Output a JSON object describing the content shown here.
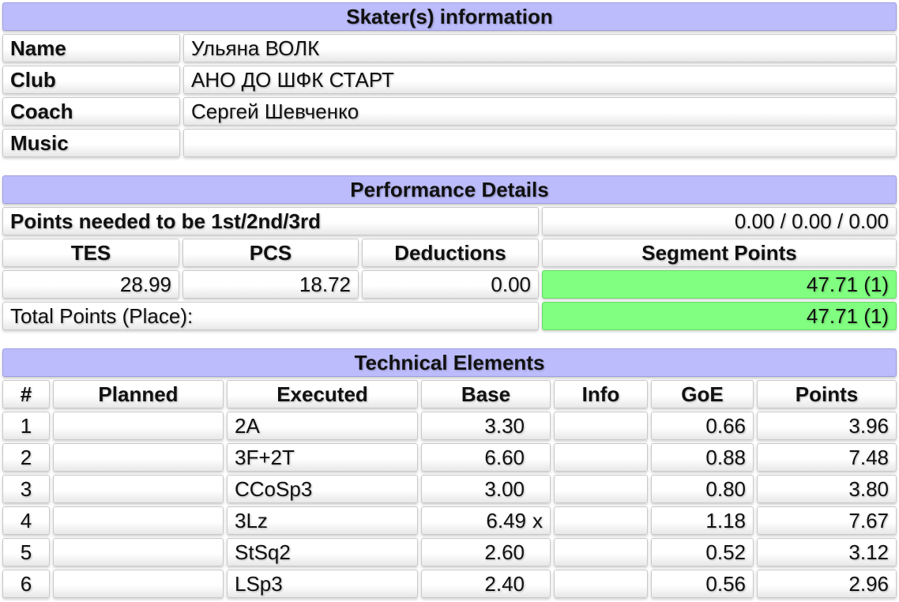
{
  "skater": {
    "header": "Skater(s) information",
    "rows": [
      {
        "label": "Name",
        "value": "Ульяна ВОЛК"
      },
      {
        "label": "Club",
        "value": "АНО ДО ШФК СТАРТ"
      },
      {
        "label": "Coach",
        "value": "Сергей Шевченко"
      },
      {
        "label": "Music",
        "value": ""
      }
    ]
  },
  "performance": {
    "header": "Performance Details",
    "needed_label": "Points needed to be 1st/2nd/3rd",
    "needed_value": "0.00 / 0.00 / 0.00",
    "columns": {
      "tes": "TES",
      "pcs": "PCS",
      "deductions": "Deductions",
      "segment": "Segment Points"
    },
    "values": {
      "tes": "28.99",
      "pcs": "18.72",
      "deductions": "0.00",
      "segment": "47.71 (1)"
    },
    "total_label": "Total Points (Place):",
    "total_value": "47.71 (1)",
    "highlight_color": "#80ff80"
  },
  "elements": {
    "header": "Technical Elements",
    "header_color": "#bcbcfc",
    "columns": [
      "#",
      "Planned",
      "Executed",
      "Base",
      "Info",
      "GoE",
      "Points"
    ],
    "rows": [
      {
        "num": "1",
        "planned": "",
        "executed": "2A",
        "base": "3.30",
        "base_mark": "",
        "info": "",
        "goe": "0.66",
        "points": "3.96"
      },
      {
        "num": "2",
        "planned": "",
        "executed": "3F+2T",
        "base": "6.60",
        "base_mark": "",
        "info": "",
        "goe": "0.88",
        "points": "7.48"
      },
      {
        "num": "3",
        "planned": "",
        "executed": "CCoSp3",
        "base": "3.00",
        "base_mark": "",
        "info": "",
        "goe": "0.80",
        "points": "3.80"
      },
      {
        "num": "4",
        "planned": "",
        "executed": "3Lz",
        "base": "6.49",
        "base_mark": "x",
        "info": "",
        "goe": "1.18",
        "points": "7.67"
      },
      {
        "num": "5",
        "planned": "",
        "executed": "StSq2",
        "base": "2.60",
        "base_mark": "",
        "info": "",
        "goe": "0.52",
        "points": "3.12"
      },
      {
        "num": "6",
        "planned": "",
        "executed": "LSp3",
        "base": "2.40",
        "base_mark": "",
        "info": "",
        "goe": "0.56",
        "points": "2.96"
      }
    ]
  }
}
